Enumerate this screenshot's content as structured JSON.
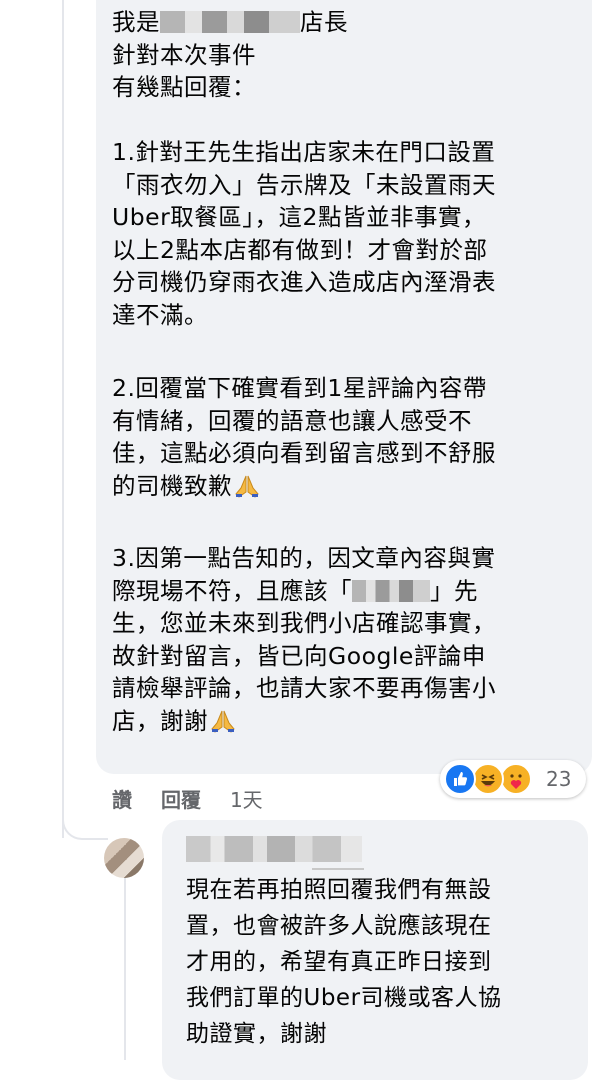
{
  "comment": {
    "intro": {
      "line1_prefix": "我是",
      "line1_suffix": "店長",
      "line2": "針對本次事件",
      "line3": "有幾點回覆："
    },
    "point1": [
      "1.針對王先生指出店家未在門口設置",
      "「雨衣勿入」告示牌及「未設置雨天",
      "Uber取餐區」，這2點皆並非事實，",
      "以上2點本店都有做到！才會對於部",
      "分司機仍穿雨衣進入造成店內溼滑表",
      "達不滿。"
    ],
    "point2": [
      "2.回覆當下確實看到1星評論內容帶",
      "有情緒，回覆的語意也讓人感受不",
      "佳，這點必須向看到留言感到不舒服",
      "的司機致歉"
    ],
    "point3": {
      "line1": "3.因第一點告知的，因文章內容與實",
      "line2_prefix": "際現場不符，且應該「",
      "line2_suffix": "」先",
      "rest": [
        "生，您並未來到我們小店確認事實，",
        "故針對留言，皆已向Google評論申",
        "請檢舉評論，也請大家不要再傷害小",
        "店，謝謝"
      ]
    },
    "actions": {
      "like": "讚",
      "reply": "回覆",
      "time": "1天"
    },
    "reactions": {
      "count": "23",
      "icons": [
        "like-icon",
        "haha-icon",
        "care-icon"
      ]
    }
  },
  "reply": {
    "lines": [
      "現在若再拍照回覆我們有無設",
      "置，也會被許多人說應該現在",
      "才用的，希望有真正昨日接到",
      "我們訂單的Uber司機或客人協",
      "助證實，謝謝"
    ]
  },
  "colors": {
    "bubble": "#f0f2f5",
    "meta_text": "#65676b",
    "like_blue": "#1877f2",
    "emoji_yellow": "#f7b125"
  }
}
